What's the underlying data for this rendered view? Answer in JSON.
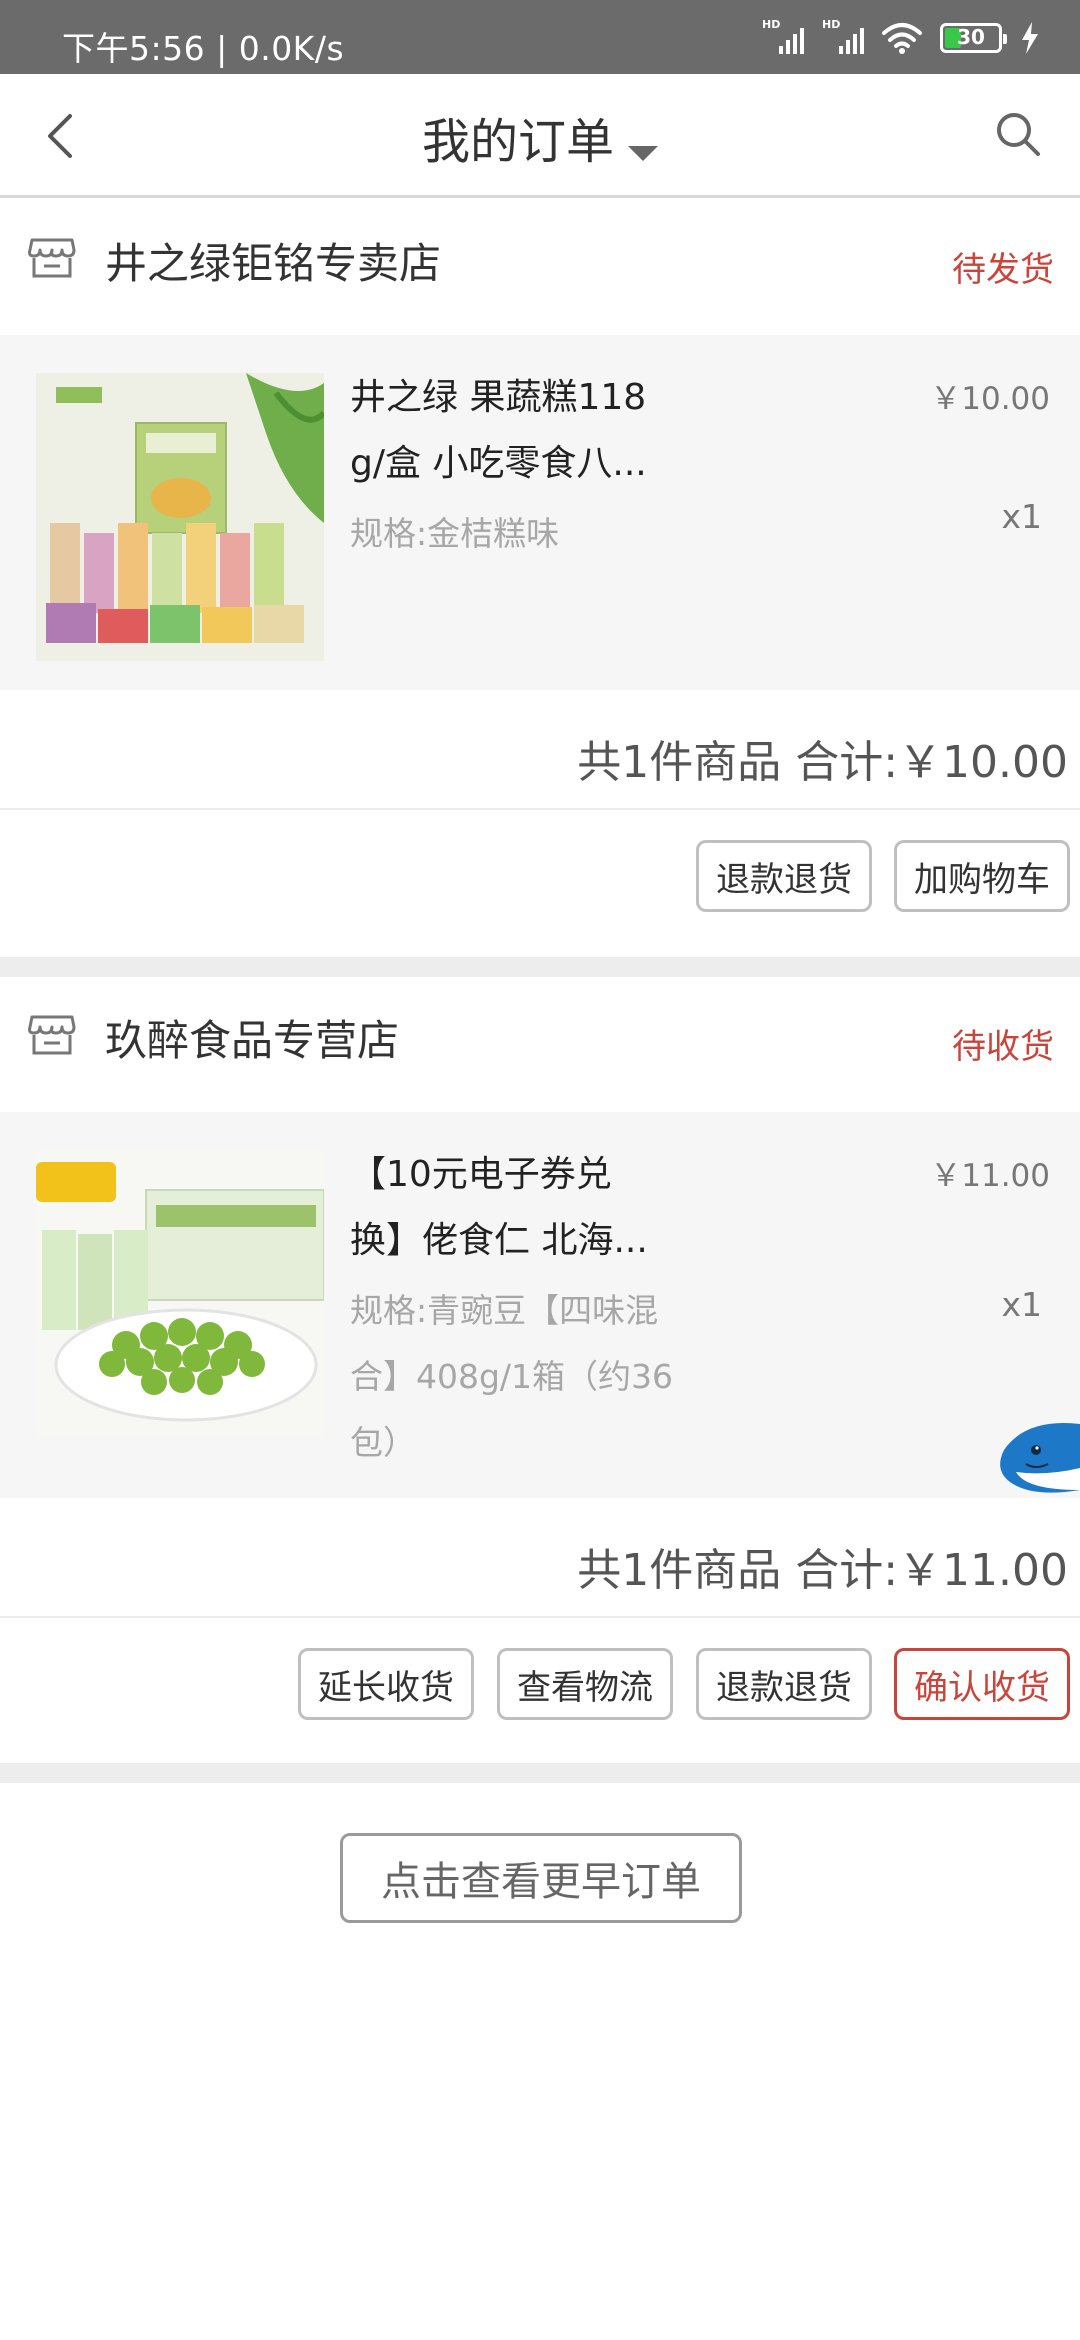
{
  "status_bar": {
    "time": "下午5:56 | 0.0K/s",
    "signal_label": "HD",
    "battery": "30",
    "battery_color": "#39c84a"
  },
  "header": {
    "title": "我的订单",
    "back_icon": "chevron-left-icon",
    "search_icon": "search-icon"
  },
  "orders": [
    {
      "shop_name": "井之绿钜铭专卖店",
      "status": "待发货",
      "item": {
        "title_line1": "井之绿 果蔬糕118",
        "title_line2": "g/盒 小吃零食八...",
        "spec_line1": "规格:金桔糕味",
        "price": "￥10.00",
        "qty": "x1"
      },
      "total": "共1件商品 合计:￥10.00",
      "buttons": [
        "退款退货",
        "加购物车"
      ]
    },
    {
      "shop_name": "玖醉食品专营店",
      "status": "待收货",
      "item": {
        "title_line1": "【10元电子券兑",
        "title_line2": "换】佬食仁 北海...",
        "spec_line1": "规格:青豌豆【四味混",
        "spec_line2": "合】408g/1箱（约36",
        "spec_line3": "包）",
        "price": "￥11.00",
        "qty": "x1"
      },
      "total": "共1件商品 合计:￥11.00",
      "buttons": [
        "延长收货",
        "查看物流",
        "退款退货",
        "确认收货"
      ]
    }
  ],
  "more_orders_label": "点击查看更早订单",
  "colors": {
    "accent_red": "#c9453c",
    "status_bar_bg": "#6b6b6b",
    "item_bg": "#f6f6f6"
  }
}
